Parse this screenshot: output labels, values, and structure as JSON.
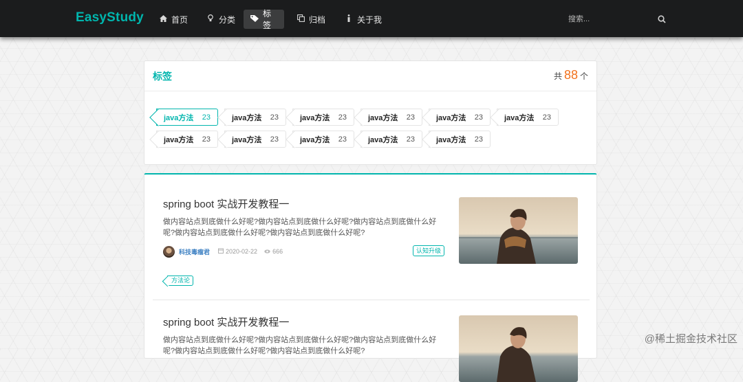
{
  "navbar": {
    "brand": "EasyStudy",
    "items": [
      {
        "label": "首页",
        "icon": "home-icon"
      },
      {
        "label": "分类",
        "icon": "lightbulb-icon"
      },
      {
        "label": "标签",
        "icon": "tag-icon",
        "active": true
      },
      {
        "label": "归档",
        "icon": "clone-icon"
      },
      {
        "label": "关于我",
        "icon": "info-icon"
      }
    ],
    "search_placeholder": "搜索...",
    "search_icon": "search-icon"
  },
  "tags_section": {
    "title": "标签",
    "total_prefix": "共",
    "total_count": "88",
    "total_suffix": "个",
    "tags": [
      {
        "name": "java方法",
        "count": "23",
        "active": true
      },
      {
        "name": "java方法",
        "count": "23"
      },
      {
        "name": "java方法",
        "count": "23"
      },
      {
        "name": "java方法",
        "count": "23"
      },
      {
        "name": "java方法",
        "count": "23"
      },
      {
        "name": "java方法",
        "count": "23"
      },
      {
        "name": "java方法",
        "count": "23"
      },
      {
        "name": "java方法",
        "count": "23"
      },
      {
        "name": "java方法",
        "count": "23"
      },
      {
        "name": "java方法",
        "count": "23"
      },
      {
        "name": "java方法",
        "count": "23"
      }
    ]
  },
  "posts": [
    {
      "title": "spring boot 实战开发教程一",
      "description": "做内容站点到底做什么好呢?做内容站点到底做什么好呢?做内容站点到底做什么好呢?做内容站点到底做什么好呢?做内容站点到底做什么好呢?",
      "author": "科技毒瘤君",
      "date": "2020-02-22",
      "views": "666",
      "category": "认知升级",
      "tag": "方法论"
    },
    {
      "title": "spring boot 实战开发教程一",
      "description": "做内容站点到底做什么好呢?做内容站点到底做什么好呢?做内容站点到底做什么好呢?做内容站点到底做什么好呢?做内容站点到底做什么好呢?"
    }
  ],
  "watermark": "@稀土掘金技术社区",
  "colors": {
    "accent": "#00b5ad",
    "count_orange": "#f2711c",
    "navbar_bg": "#1b1c1d",
    "author_blue": "#4183c4"
  }
}
